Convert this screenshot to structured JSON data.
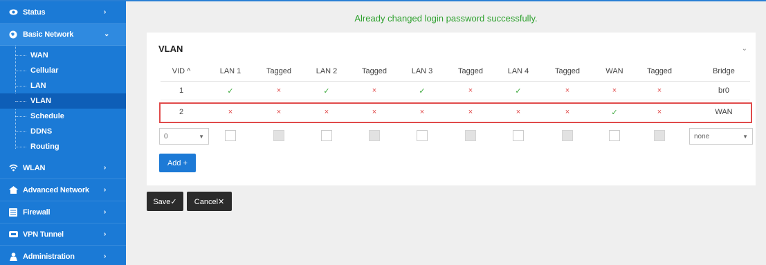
{
  "sidebar": {
    "status": "Status",
    "basic_network": "Basic Network",
    "sub_items": [
      "WAN",
      "Cellular",
      "LAN",
      "VLAN",
      "Schedule",
      "DDNS",
      "Routing"
    ],
    "wlan": "WLAN",
    "advanced_network": "Advanced Network",
    "firewall": "Firewall",
    "vpn_tunnel": "VPN Tunnel",
    "administration": "Administration",
    "active_item": "VLAN",
    "bg_color": "#1b7ad6"
  },
  "message": "Already changed login password successfully.",
  "vlan": {
    "title": "VLAN",
    "headers": [
      "VID ^",
      "LAN 1",
      "Tagged",
      "LAN 2",
      "Tagged",
      "LAN 3",
      "Tagged",
      "LAN 4",
      "Tagged",
      "WAN",
      "Tagged",
      "Bridge"
    ],
    "rows": [
      {
        "vid": "1",
        "marks": [
          "✓",
          "×",
          "✓",
          "×",
          "✓",
          "×",
          "✓",
          "×",
          "×",
          "×"
        ],
        "bridge": "br0"
      },
      {
        "vid": "2",
        "marks": [
          "×",
          "×",
          "×",
          "×",
          "×",
          "×",
          "×",
          "×",
          "✓",
          "×"
        ],
        "bridge": "WAN"
      }
    ],
    "new_vid": "0",
    "new_bridge": "none",
    "add_label": "Add +"
  },
  "buttons": {
    "save": "Save✓",
    "cancel": "Cancel✕"
  },
  "colors": {
    "accent": "#1d7ad6",
    "ok": "#39a839",
    "no": "#e04848",
    "message": "#2ea12e"
  }
}
